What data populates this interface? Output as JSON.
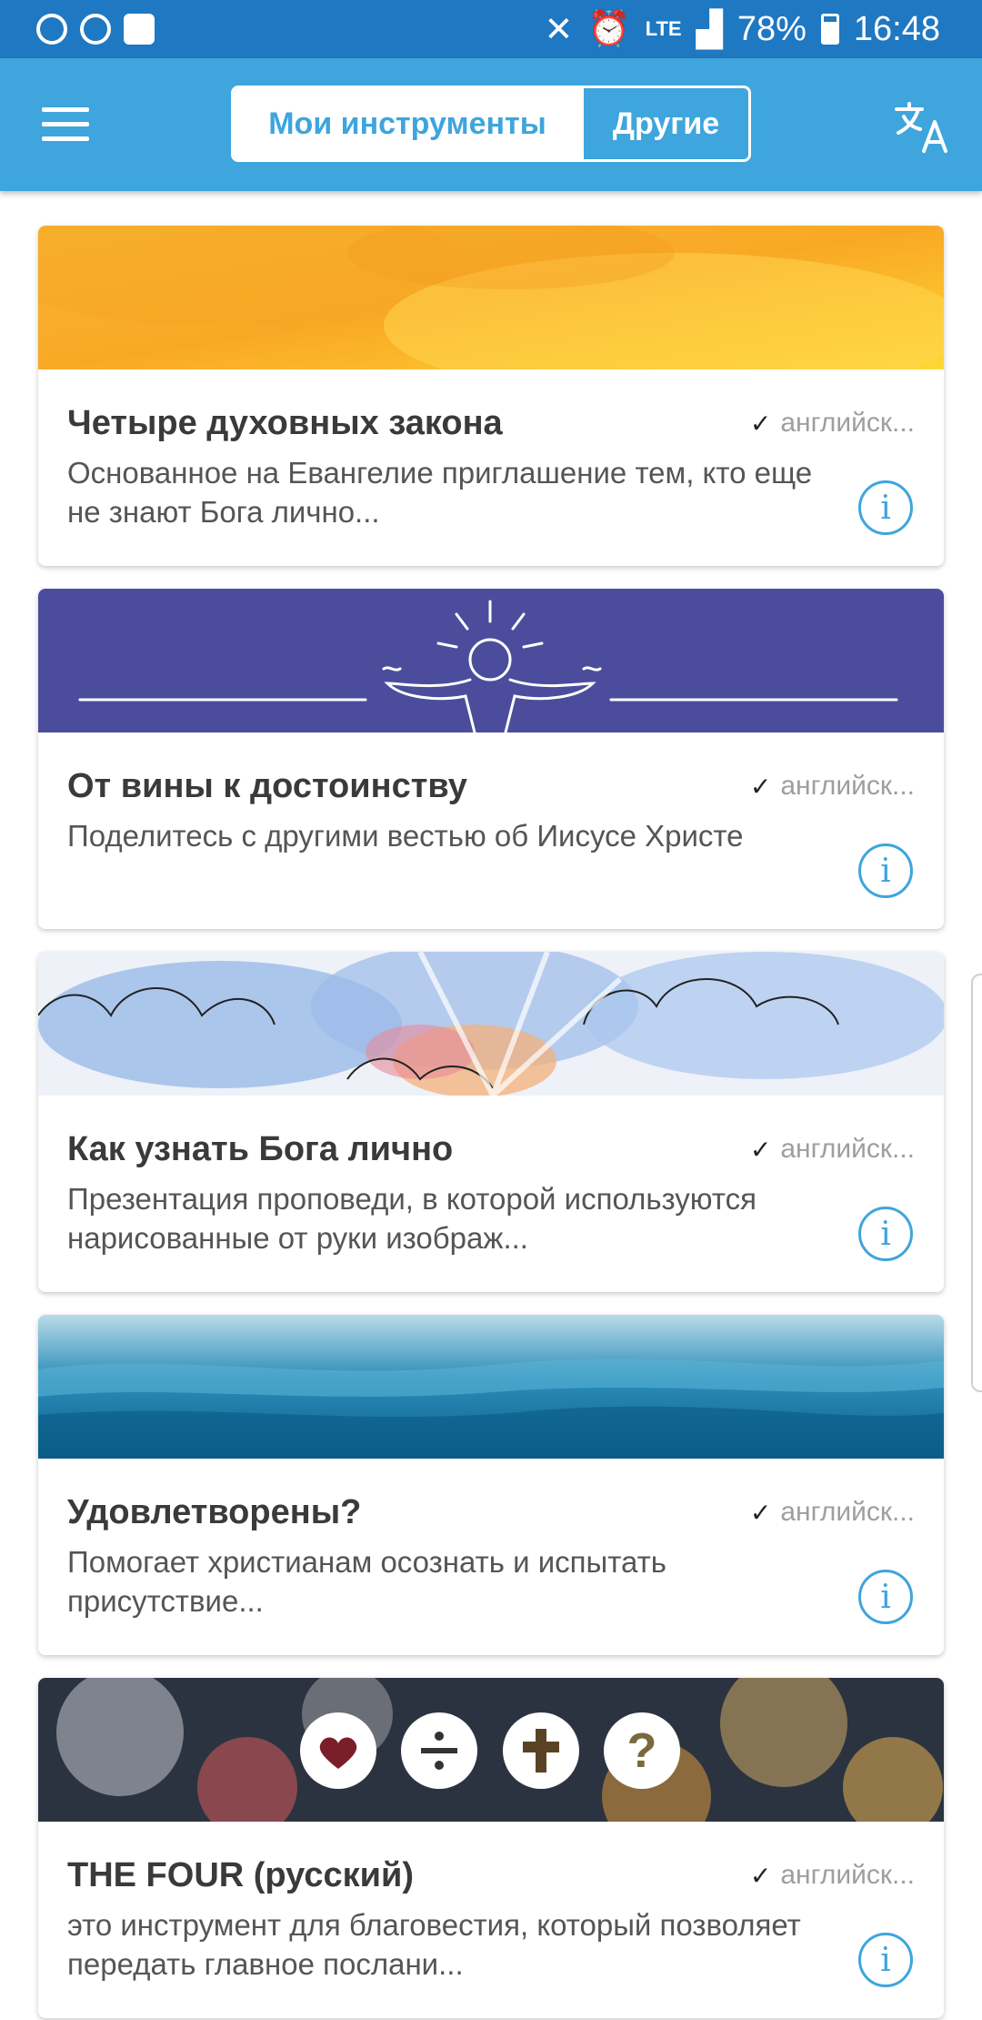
{
  "status_bar": {
    "lte": "LTE",
    "battery": "78%",
    "time": "16:48"
  },
  "app_bar": {
    "tab_mine": "Мои инструменты",
    "tab_other": "Другие",
    "colors": {
      "bar": "#3ea5dd",
      "status": "#1f78c2"
    }
  },
  "tools": [
    {
      "title": "Четыре духовных закона",
      "language": "английск...",
      "description": "Основанное на Евангелие приглашение тем, кто еще не знают Бога лично...",
      "banner": "orange-watercolor"
    },
    {
      "title": "От вины к достоинству",
      "language": "английск...",
      "description": "Поделитесь с другими вестью об Иисусе Христе",
      "banner": "purple-figure-sun"
    },
    {
      "title": "Как узнать Бога лично",
      "language": "английск...",
      "description": "Презентация проповеди, в которой используются нарисованные от руки изображ...",
      "banner": "clouds-watercolor"
    },
    {
      "title": "Удовлетворены?",
      "language": "английск...",
      "description": "Помогает христианам осознать и испытать присутствие...",
      "banner": "ocean-water"
    },
    {
      "title": "THE FOUR (русский)",
      "language": "английск...",
      "description": "это инструмент для благовестия, который позволяет передать главное послани...",
      "banner": "bokeh-four-icons"
    }
  ]
}
